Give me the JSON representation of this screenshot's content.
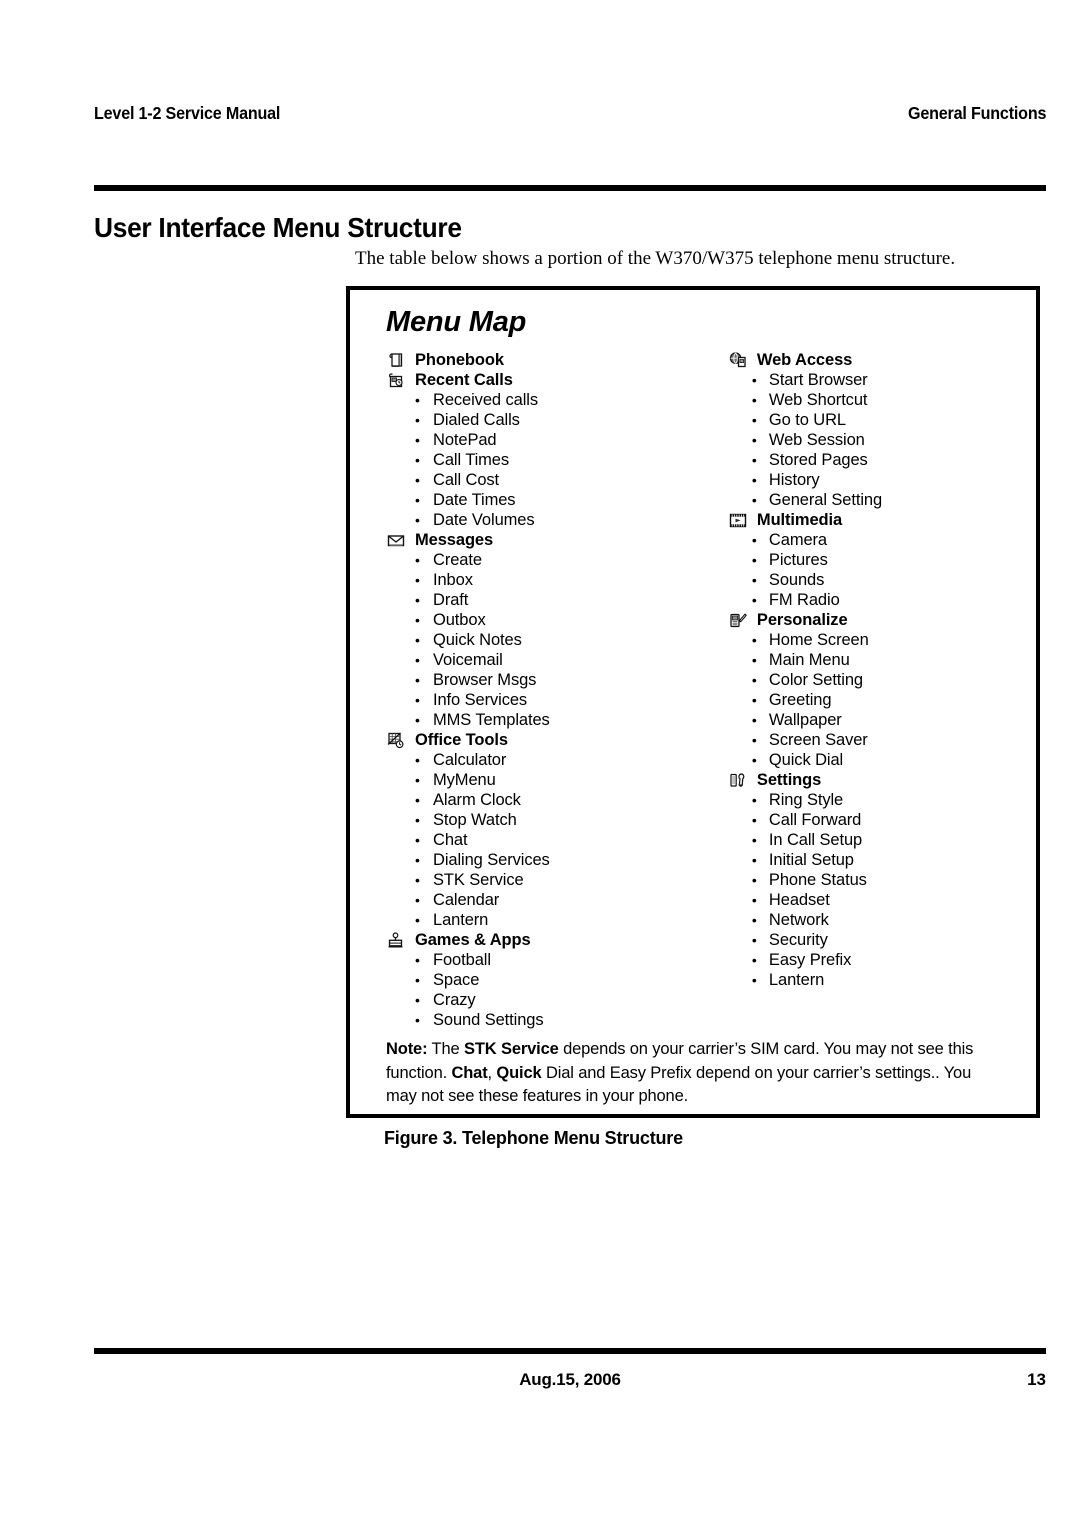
{
  "header": {
    "left": "Level 1-2 Service Manual",
    "right": "General Functions"
  },
  "section": {
    "title": "User Interface Menu Structure",
    "intro": "The table below shows a portion of the W370/W375 telephone menu structure."
  },
  "menu_map": {
    "title": "Menu Map",
    "left_column": [
      {
        "icon": "phonebook-icon",
        "label": "Phonebook",
        "items": []
      },
      {
        "icon": "recent-calls-icon",
        "label": "Recent Calls",
        "items": [
          "Received calls",
          "Dialed Calls",
          "NotePad",
          "Call Times",
          "Call Cost",
          "Date Times",
          "Date Volumes"
        ]
      },
      {
        "icon": "messages-envelope-icon",
        "label": "Messages",
        "items": [
          "Create",
          "Inbox",
          "Draft",
          "Outbox",
          "Quick Notes",
          "Voicemail",
          "Browser Msgs",
          "Info Services",
          "MMS Templates"
        ]
      },
      {
        "icon": "office-tools-icon",
        "label": "Office Tools",
        "items": [
          "Calculator",
          "MyMenu",
          "Alarm Clock",
          "Stop Watch",
          "Chat",
          "Dialing Services",
          "STK Service",
          "Calendar",
          "Lantern"
        ]
      },
      {
        "icon": "games-apps-joystick-icon",
        "label": "Games & Apps",
        "items": [
          "Football",
          "Space",
          "Crazy",
          "Sound Settings"
        ]
      }
    ],
    "right_column": [
      {
        "icon": "web-access-globe-icon",
        "label": "Web Access",
        "items": [
          "Start Browser",
          "Web Shortcut",
          "Go to URL",
          "Web Session",
          "Stored Pages",
          "History",
          "General Setting"
        ]
      },
      {
        "icon": "multimedia-filmstrip-icon",
        "label": "Multimedia",
        "items": [
          "Camera",
          "Pictures",
          "Sounds",
          "FM Radio"
        ]
      },
      {
        "icon": "personalize-pencil-phone-icon",
        "label": "Personalize",
        "items": [
          "Home Screen",
          "Main Menu",
          "Color Setting",
          "Greeting",
          "Wallpaper",
          "Screen Saver",
          "Quick Dial"
        ]
      },
      {
        "icon": "settings-wrench-icon",
        "label": "Settings",
        "items": [
          "Ring Style",
          "Call Forward",
          "In Call Setup",
          "Initial Setup",
          "Phone Status",
          "Headset",
          "Network",
          "Security",
          "Easy Prefix",
          "Lantern"
        ]
      }
    ],
    "note": {
      "label": "Note:",
      "part1": " The ",
      "bold1": "STK Service",
      "part2": " depends on your carrier’s SIM card. You may not see this function. ",
      "bold2": "Chat",
      "part3": ", ",
      "bold3": "Quick",
      "part4": " Dial and Easy Prefix depend on your carrier’s settings.. You may not see these features in your phone."
    }
  },
  "figure": {
    "caption": "Figure 3.  Telephone Menu Structure"
  },
  "footer": {
    "date": "Aug.15, 2006",
    "page": "13"
  }
}
